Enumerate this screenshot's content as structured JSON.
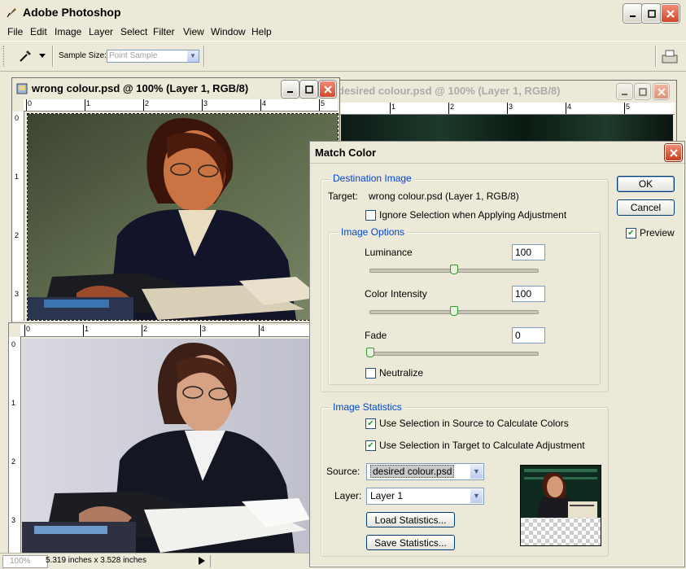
{
  "app": {
    "title": "Adobe Photoshop",
    "menu": [
      "File",
      "Edit",
      "Image",
      "Layer",
      "Select",
      "Filter",
      "View",
      "Window",
      "Help"
    ]
  },
  "options_bar": {
    "sample_size_label": "Sample Size:",
    "sample_size_value": "Point Sample"
  },
  "documents": {
    "wrong": {
      "title": "wrong colour.psd @ 100% (Layer 1, RGB/8)"
    },
    "desired": {
      "title": "desired colour.psd @ 100% (Layer 1, RGB/8)"
    },
    "ruler_h_numbers": [
      "0",
      "1",
      "2",
      "3",
      "4",
      "5"
    ],
    "ruler_v_numbers": [
      "0",
      "1",
      "2",
      "3"
    ],
    "ruler2_h_numbers": [
      "0",
      "1",
      "2",
      "3",
      "4"
    ],
    "ruler2_v_numbers": [
      "0",
      "1",
      "2",
      "3"
    ]
  },
  "status": {
    "zoom": "100%",
    "doc_size": "5.319 inches x 3.528 inches"
  },
  "dialog": {
    "title": "Match Color",
    "ok": "OK",
    "cancel": "Cancel",
    "preview": "Preview",
    "preview_checked": true,
    "destination": {
      "legend": "Destination Image",
      "target_label": "Target:",
      "target_value": "wrong colour.psd (Layer 1, RGB/8)",
      "ignore_selection": "Ignore Selection when Applying Adjustment",
      "ignore_checked": false
    },
    "image_options": {
      "legend": "Image Options",
      "luminance_label": "Luminance",
      "luminance_value": "100",
      "color_intensity_label": "Color Intensity",
      "color_intensity_value": "100",
      "fade_label": "Fade",
      "fade_value": "0",
      "neutralize": "Neutralize",
      "neutralize_checked": false,
      "luminance_level": 0.5,
      "color_intensity_level": 0.5,
      "fade_level": 0.0
    },
    "statistics": {
      "legend": "Image Statistics",
      "use_source": "Use Selection in Source to Calculate Colors",
      "use_target": "Use Selection in Target to Calculate Adjustment",
      "source_label": "Source:",
      "source_value": "desired colour.psd",
      "layer_label": "Layer:",
      "layer_value": "Layer 1",
      "load": "Load Statistics...",
      "save": "Save Statistics..."
    }
  },
  "colors": {
    "legend_blue": "#0046d5",
    "close_red": "#d3492b",
    "check_green": "#21a121"
  }
}
